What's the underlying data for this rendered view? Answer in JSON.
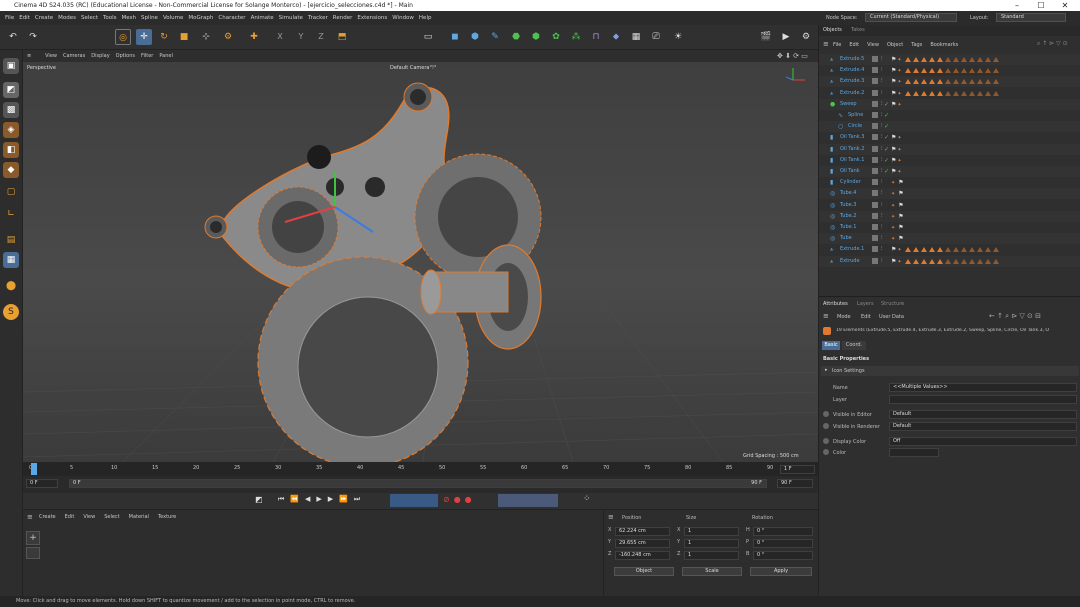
{
  "window": {
    "title": "Cinema 4D S24.035 (RC) (Educational License - Non-Commercial License for Solange  Monterco) - [ejercicio_selecciones.c4d *] - Main",
    "minimize": "–",
    "maximize": "☐",
    "close": "✕"
  },
  "menu": [
    "File",
    "Edit",
    "Create",
    "Modes",
    "Select",
    "Tools",
    "Mesh",
    "Spline",
    "Volume",
    "MoGraph",
    "Character",
    "Animate",
    "Simulate",
    "Tracker",
    "Render",
    "Extensions",
    "Window",
    "Help"
  ],
  "node_space": {
    "label": "Node Space:",
    "value": "Current (Standard/Physical)"
  },
  "layout": {
    "label": "Layout:",
    "value": "Standard"
  },
  "toolbar": {
    "axis_x": "X",
    "axis_y": "Y",
    "axis_z": "Z"
  },
  "viewport": {
    "menu": [
      "View",
      "Cameras",
      "Display",
      "Options",
      "Filter",
      "Panel"
    ],
    "label": "Perspective",
    "camera": "Default Camera°!°",
    "grid_spacing": "Grid Spacing : 500 cm"
  },
  "timeline": {
    "ticks": [
      "0",
      "5",
      "10",
      "15",
      "20",
      "25",
      "30",
      "35",
      "40",
      "45",
      "50",
      "55",
      "60",
      "65",
      "70",
      "75",
      "80",
      "85",
      "90"
    ],
    "current": "0 F",
    "start": "0 F",
    "min": "0 F",
    "end": "90 F",
    "max": "90 F",
    "frame_end": "1 F"
  },
  "material": {
    "menu": [
      "Create",
      "Edit",
      "View",
      "Select",
      "Material",
      "Texture"
    ]
  },
  "coordinates": {
    "headers": [
      "Position",
      "Size",
      "Rotation"
    ],
    "rows": [
      {
        "axis": "X",
        "pos": "62.224 cm",
        "size_axis": "X",
        "size": "1",
        "rot_axis": "H",
        "rot": "0 °"
      },
      {
        "axis": "Y",
        "pos": "29.655 cm",
        "size_axis": "Y",
        "size": "1",
        "rot_axis": "P",
        "rot": "0 °"
      },
      {
        "axis": "Z",
        "pos": "-160.248 cm",
        "size_axis": "Z",
        "size": "1",
        "rot_axis": "B",
        "rot": "0 °"
      }
    ],
    "mode": "Object",
    "size_mode": "Scale",
    "apply": "Apply"
  },
  "status": "Move: Click and drag to move elements. Hold down SHIFT to quantize movement / add to the selection in point mode, CTRL to remove.",
  "objects": {
    "tabs": [
      "Objects",
      "Takes"
    ],
    "menu": [
      "File",
      "Edit",
      "View",
      "Object",
      "Tags",
      "Bookmarks"
    ],
    "items": [
      {
        "name": "Extrude.5",
        "icon": "extrude-icon",
        "tags": 12
      },
      {
        "name": "Extrude.4",
        "icon": "extrude-icon",
        "tags": 12
      },
      {
        "name": "Extrude.3",
        "icon": "extrude-icon",
        "tags": 12
      },
      {
        "name": "Extrude.2",
        "icon": "extrude-icon",
        "tags": 12
      },
      {
        "name": "Sweep",
        "icon": "sweep-icon",
        "tags": 0
      },
      {
        "name": "Spline",
        "icon": "spline-icon",
        "tags": 0
      },
      {
        "name": "Circle",
        "icon": "circle-icon",
        "tags": 0
      },
      {
        "name": "Oil Tank.3",
        "icon": "oiltank-icon",
        "tags": 0
      },
      {
        "name": "Oil Tank.2",
        "icon": "oiltank-icon",
        "tags": 0
      },
      {
        "name": "Oil Tank.1",
        "icon": "oiltank-icon",
        "tags": 0
      },
      {
        "name": "Oil Tank",
        "icon": "oiltank-icon",
        "tags": 0
      },
      {
        "name": "Cylinder",
        "icon": "cylinder-icon",
        "tags": 0
      },
      {
        "name": "Tube.4",
        "icon": "tube-icon",
        "tags": 0
      },
      {
        "name": "Tube.3",
        "icon": "tube-icon",
        "tags": 0
      },
      {
        "name": "Tube.2",
        "icon": "tube-icon",
        "tags": 0
      },
      {
        "name": "Tube.1",
        "icon": "tube-icon",
        "tags": 0
      },
      {
        "name": "Tube",
        "icon": "tube-icon",
        "tags": 0
      },
      {
        "name": "Extrude.1",
        "icon": "extrude-icon",
        "tags": 12
      },
      {
        "name": "Extrude",
        "icon": "extrude-icon",
        "tags": 12
      }
    ]
  },
  "attributes": {
    "tabs": [
      "Attributes",
      "Layers",
      "Structure"
    ],
    "menu": [
      "Mode",
      "Edit",
      "User Data"
    ],
    "selection": "19 Elements (Extrude.5, Extrude.4, Extrude.3, Extrude.2, Sweep, Spline, Circle, Oil Tank.3, O",
    "subtabs": [
      "Basic",
      "Coord."
    ],
    "section": "Basic Properties",
    "group": "Icon Settings",
    "fields": [
      {
        "label": "Name",
        "value": "<<Multiple Values>>"
      },
      {
        "label": "Layer",
        "value": ""
      },
      {
        "label": "Visible in Editor",
        "value": "Default"
      },
      {
        "label": "Visible in Renderer",
        "value": "Default"
      },
      {
        "label": "Display Color",
        "value": "Off"
      },
      {
        "label": "Color",
        "value": ""
      }
    ]
  }
}
